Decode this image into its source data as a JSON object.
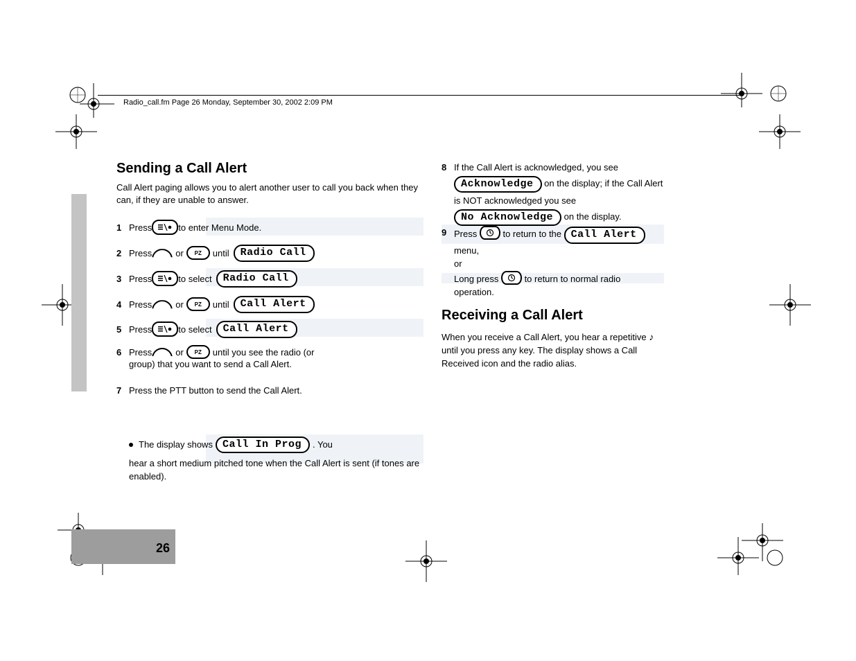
{
  "header": "Radio_call.fm  Page 26  Monday, September 30, 2002  2:09 PM",
  "page_number": "26",
  "headings": {
    "send_call_alert": "Sending a Call Alert",
    "receive_call_alert": "Receiving a Call Alert"
  },
  "left": {
    "intro": "Call Alert paging allows you to alert another user to call you back when they can, if they are unable to answer.",
    "step1_a": "Press ",
    "step1_b": " to enter Menu Mode.",
    "step2_a": "Press ",
    "step2_or": " or ",
    "step2_b": " until ",
    "step3_a": "Press ",
    "step3_b": " to select ",
    "step4_a": "Press ",
    "step4_or": " or ",
    "step4_b": " until ",
    "step5_a": "Press ",
    "step5_b": " to select ",
    "step6_a": "Press ",
    "step6_or": " or ",
    "step6_b": " until you see the radio (or ",
    "step6_c": "group) that you want to send a Call Alert.",
    "step7_a": "Press the PTT button to send the Call Alert.",
    "step7_b": "The display shows ",
    "step7_c": ". You",
    "step7_d": "hear a short medium pitched tone when the Call Alert is sent (if tones are enabled)."
  },
  "right": {
    "r8_a": "If the Call Alert is acknowledged, you see",
    "r8_b": " on the display; if the Call Alert",
    "r8_c": "is NOT acknowledged you see",
    "r8_d": " on the display.",
    "r9_a": "Press ",
    "r9_b": " to return to the ",
    "r9_c": " menu,",
    "r9_d": "or",
    "r9_e": "Long press ",
    "r9_f": " to return to normal radio",
    "r9_g": "operation.",
    "recv_1": "When you receive a Call Alert, you hear a",
    "recv_2": "repetitive ",
    "recv_3": " until you press any key. The display",
    "recv_4": "shows a Call Received icon and the radio alias."
  },
  "pills": {
    "radio_call": "Radio Call",
    "call_alert": "Call Alert",
    "call_in_prog": "Call In Prog",
    "acknowledge": "Acknowledge",
    "no_acknowledge": "No Acknowledge"
  }
}
